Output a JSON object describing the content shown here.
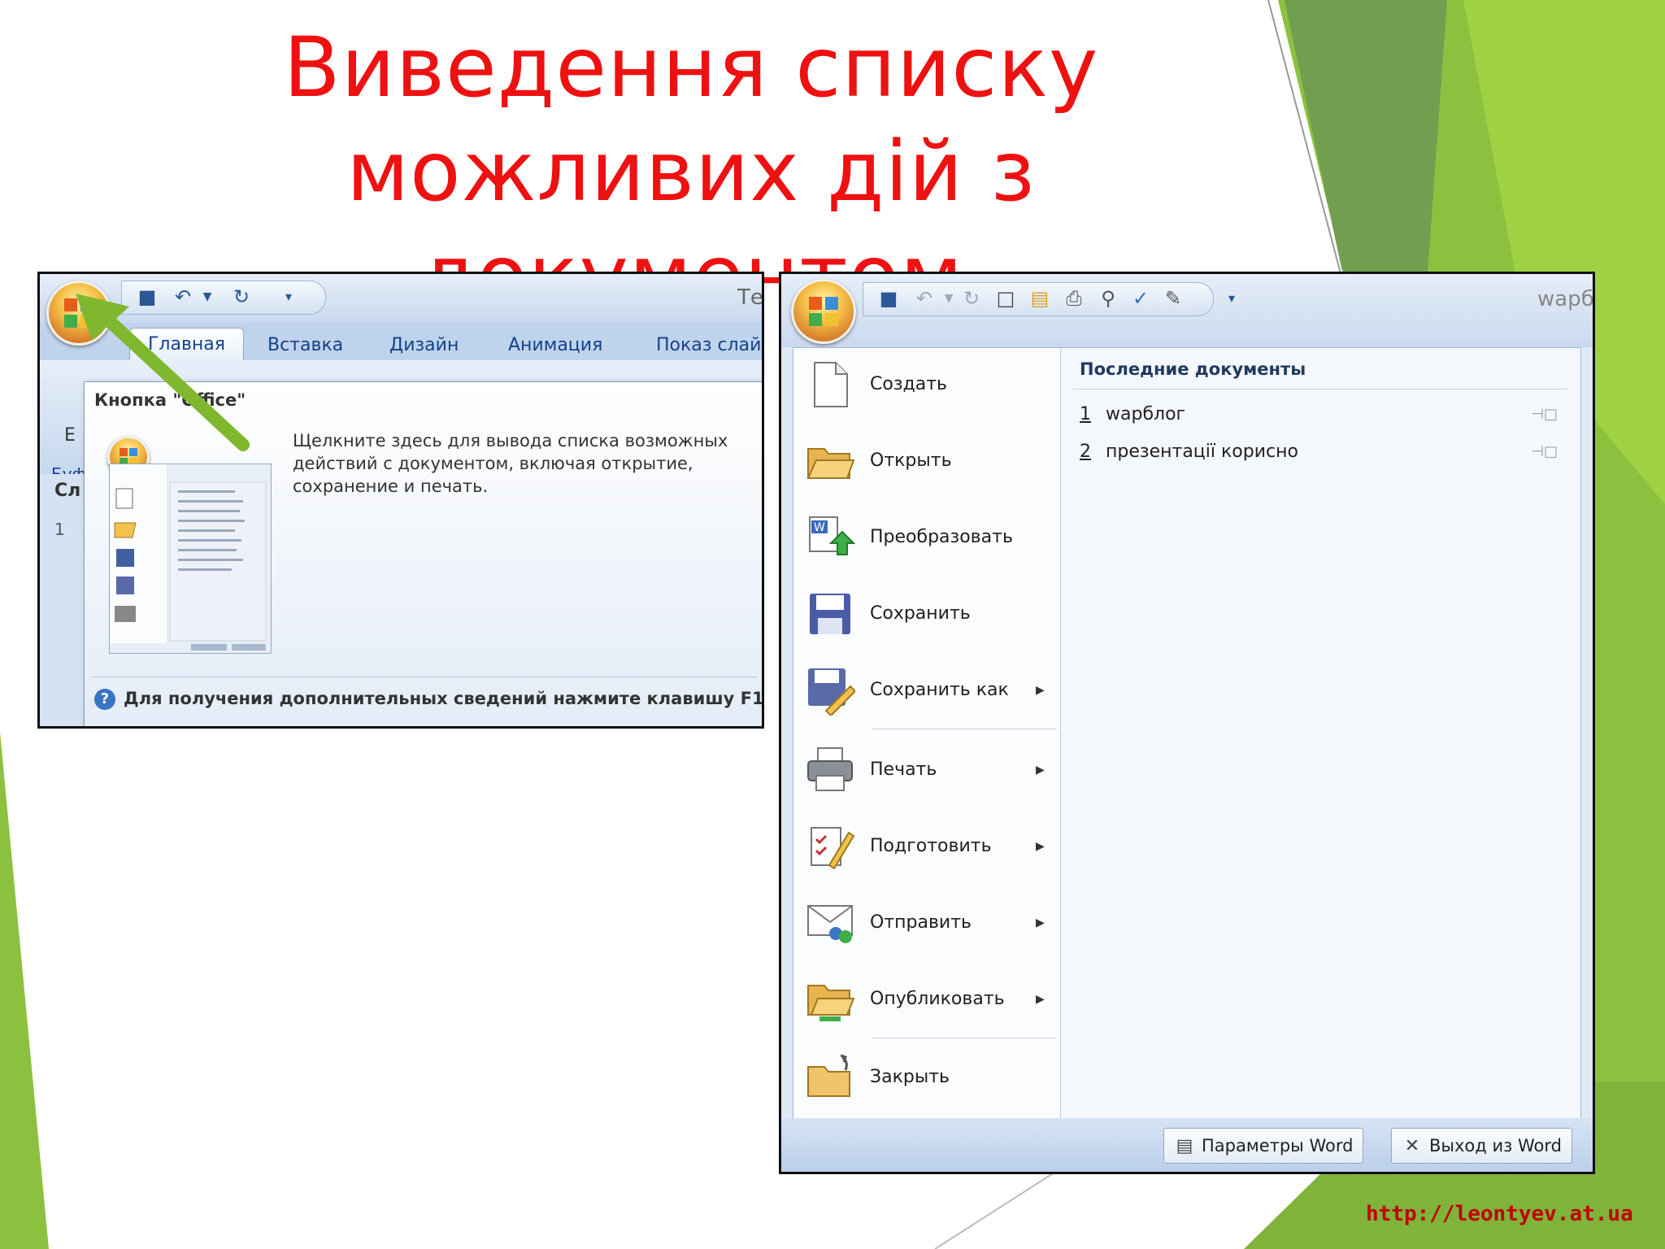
{
  "slide": {
    "title": "Виведення списку можливих дій з документом",
    "source_link": "http://leontyev.at.ua"
  },
  "left_screenshot": {
    "window_title_partial": "Те",
    "tabs": [
      "Главная",
      "Вставка",
      "Дизайн",
      "Анимация",
      "Показ слай"
    ],
    "ribbon_fragments": [
      "Е",
      "Буф"
    ],
    "side_pane": {
      "tab_partial": "Сл",
      "slide_number": "1"
    },
    "tooltip": {
      "title": "Кнопка \"Office\"",
      "description": "Щелкните здесь для вывода списка возможных действий с документом, включая открытие, сохранение и печать.",
      "help_text": "Для получения дополнительных сведений нажмите клавишу F1."
    }
  },
  "right_screenshot": {
    "window_title_partial": "wapб",
    "commands": [
      {
        "label": "Создать",
        "icon": "new-document-icon",
        "submenu": false
      },
      {
        "label": "Открыть",
        "icon": "open-folder-icon",
        "submenu": false
      },
      {
        "label": "Преобразовать",
        "icon": "convert-icon",
        "submenu": false
      },
      {
        "label": "Сохранить",
        "icon": "save-icon",
        "submenu": false
      },
      {
        "label": "Сохранить как",
        "icon": "save-as-icon",
        "submenu": true
      },
      {
        "label": "Печать",
        "icon": "print-icon",
        "submenu": true
      },
      {
        "label": "Подготовить",
        "icon": "prepare-icon",
        "submenu": true
      },
      {
        "label": "Отправить",
        "icon": "send-icon",
        "submenu": true
      },
      {
        "label": "Опубликовать",
        "icon": "publish-icon",
        "submenu": true
      },
      {
        "label": "Закрыть",
        "icon": "close-folder-icon",
        "submenu": false
      }
    ],
    "recent": {
      "title": "Последние документы",
      "items": [
        {
          "number": "1",
          "name": "wapблог"
        },
        {
          "number": "2",
          "name": "презентації корисно"
        }
      ]
    },
    "footer": {
      "options_button": "Параметры Word",
      "exit_button": "Выход из Word"
    }
  },
  "colors": {
    "title_red": "#ee1111",
    "link_red": "#c00000",
    "green_light": "#8dc63f",
    "green_dark": "#5a8a3a"
  }
}
